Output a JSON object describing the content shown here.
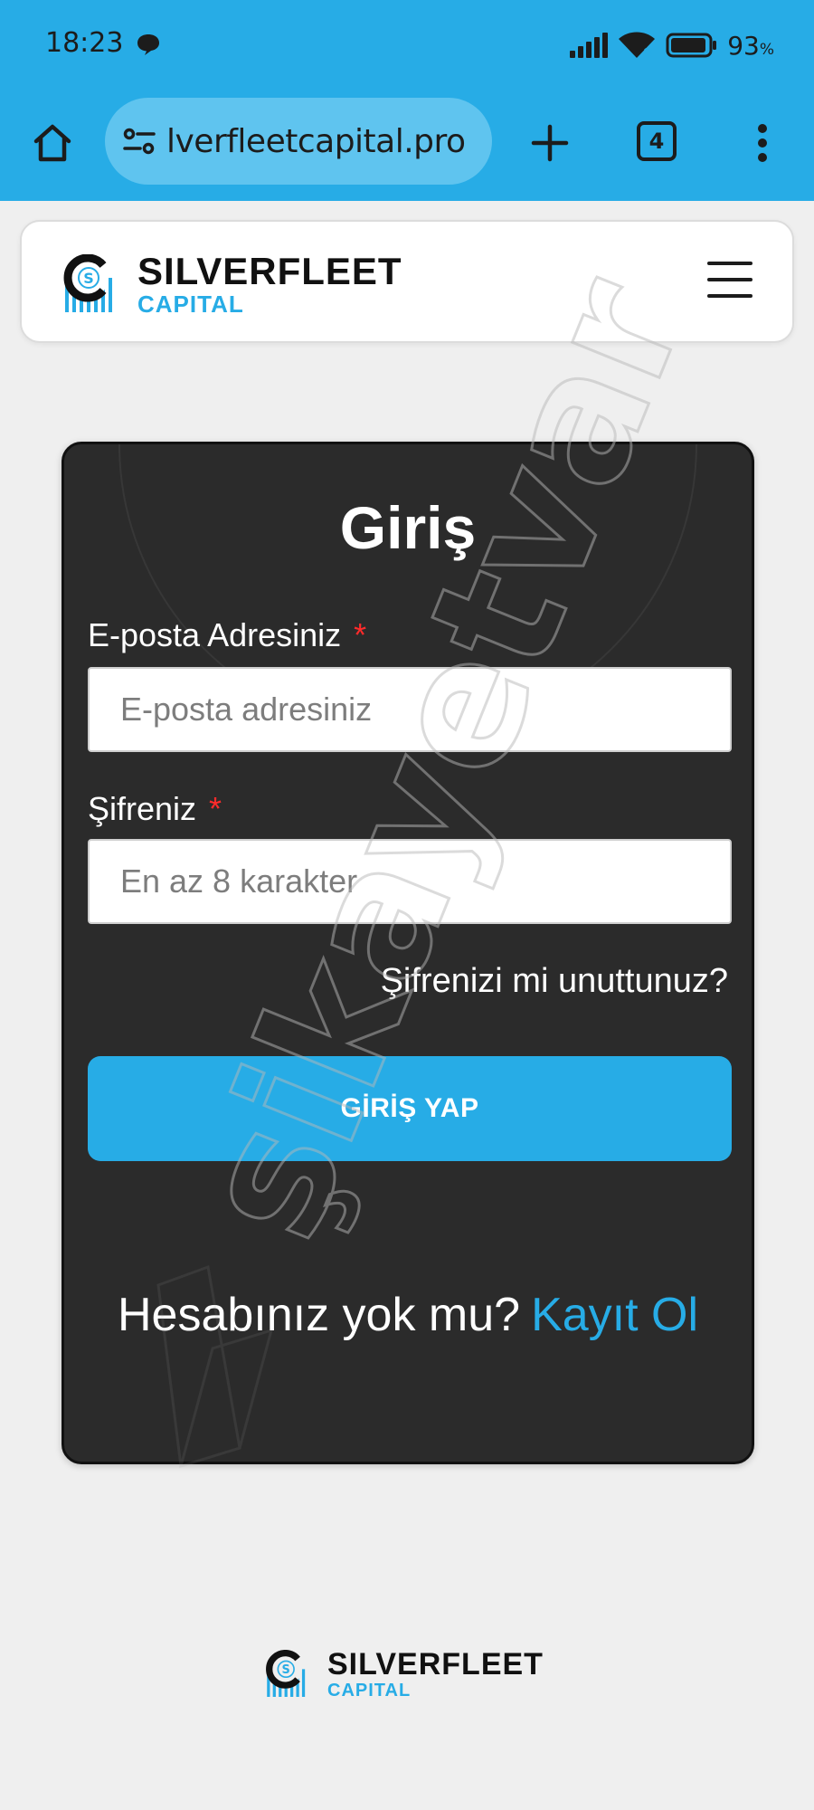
{
  "status_bar": {
    "time": "18:23",
    "battery_percent": "93",
    "battery_unit": "%"
  },
  "browser": {
    "url": "lverfleetcapital.pro",
    "tab_count": "4",
    "chrome_color": "#27ace6",
    "icons": {
      "home": "home-icon",
      "site_settings": "tune-icon",
      "new_tab": "plus-icon",
      "menu": "more-vert-icon"
    }
  },
  "header": {
    "brand_name": "SILVERFLEET",
    "brand_sub": "CAPITAL",
    "brand_color": "#27ace6",
    "menu_icon": "hamburger-icon"
  },
  "login": {
    "title": "Giriş",
    "email_label": "E-posta Adresiniz",
    "email_placeholder": "E-posta adresiniz",
    "email_value": "",
    "password_label": "Şifreniz",
    "password_placeholder": "En az 8 karakter",
    "password_value": "",
    "required_marker": "*",
    "forgot_password": "Şifrenizi mi unuttunuz?",
    "submit_label": "GİRİŞ YAP",
    "no_account_text": "Hesabınız yok mu?",
    "register_link": "Kayıt Ol",
    "card_color": "#2b2b2b",
    "accent_color": "#27ace6"
  },
  "footer": {
    "brand_name": "SILVERFLEET",
    "brand_sub": "CAPITAL"
  },
  "watermark": {
    "text": "şikayetvar"
  }
}
